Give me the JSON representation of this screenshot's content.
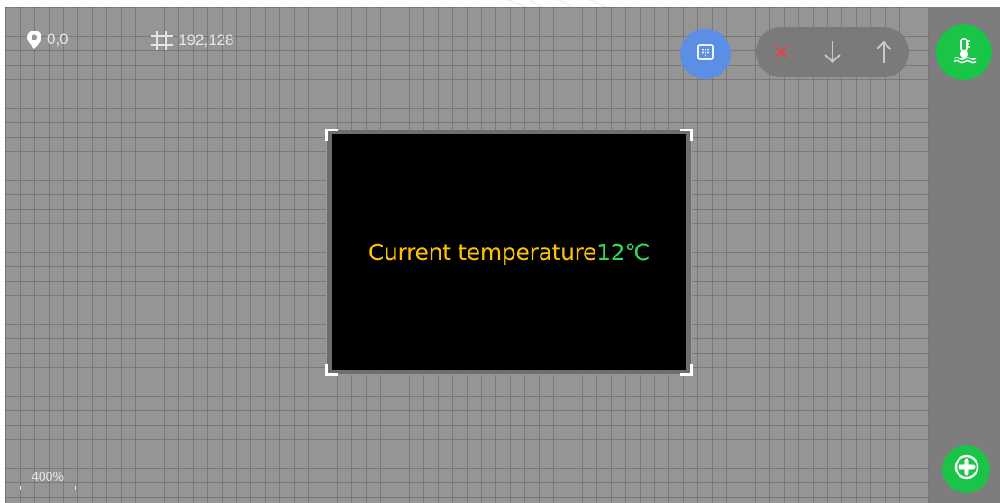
{
  "status": {
    "position": "0,0",
    "size": "192,128",
    "position_icon": "location-pin-icon",
    "size_icon": "crop-icon"
  },
  "display": {
    "label": "Current temperature",
    "value": "12℃",
    "background": "#000000",
    "label_color": "#ffc400",
    "value_color": "#35d85b"
  },
  "toolbar": {
    "grid_icon": "grid-icon",
    "delete_icon": "close-icon",
    "move_down_icon": "arrow-down-icon",
    "move_up_icon": "arrow-up-icon"
  },
  "side_panel": {
    "temperature_icon": "thermometer-icon",
    "add_icon": "add-icon"
  },
  "zoom": {
    "label": "400%"
  },
  "colors": {
    "canvas": "#959595",
    "side_panel": "#7d7d7d",
    "accent_blue": "#5b8fe6",
    "accent_green": "#19c446",
    "delete_red": "#e74040"
  }
}
